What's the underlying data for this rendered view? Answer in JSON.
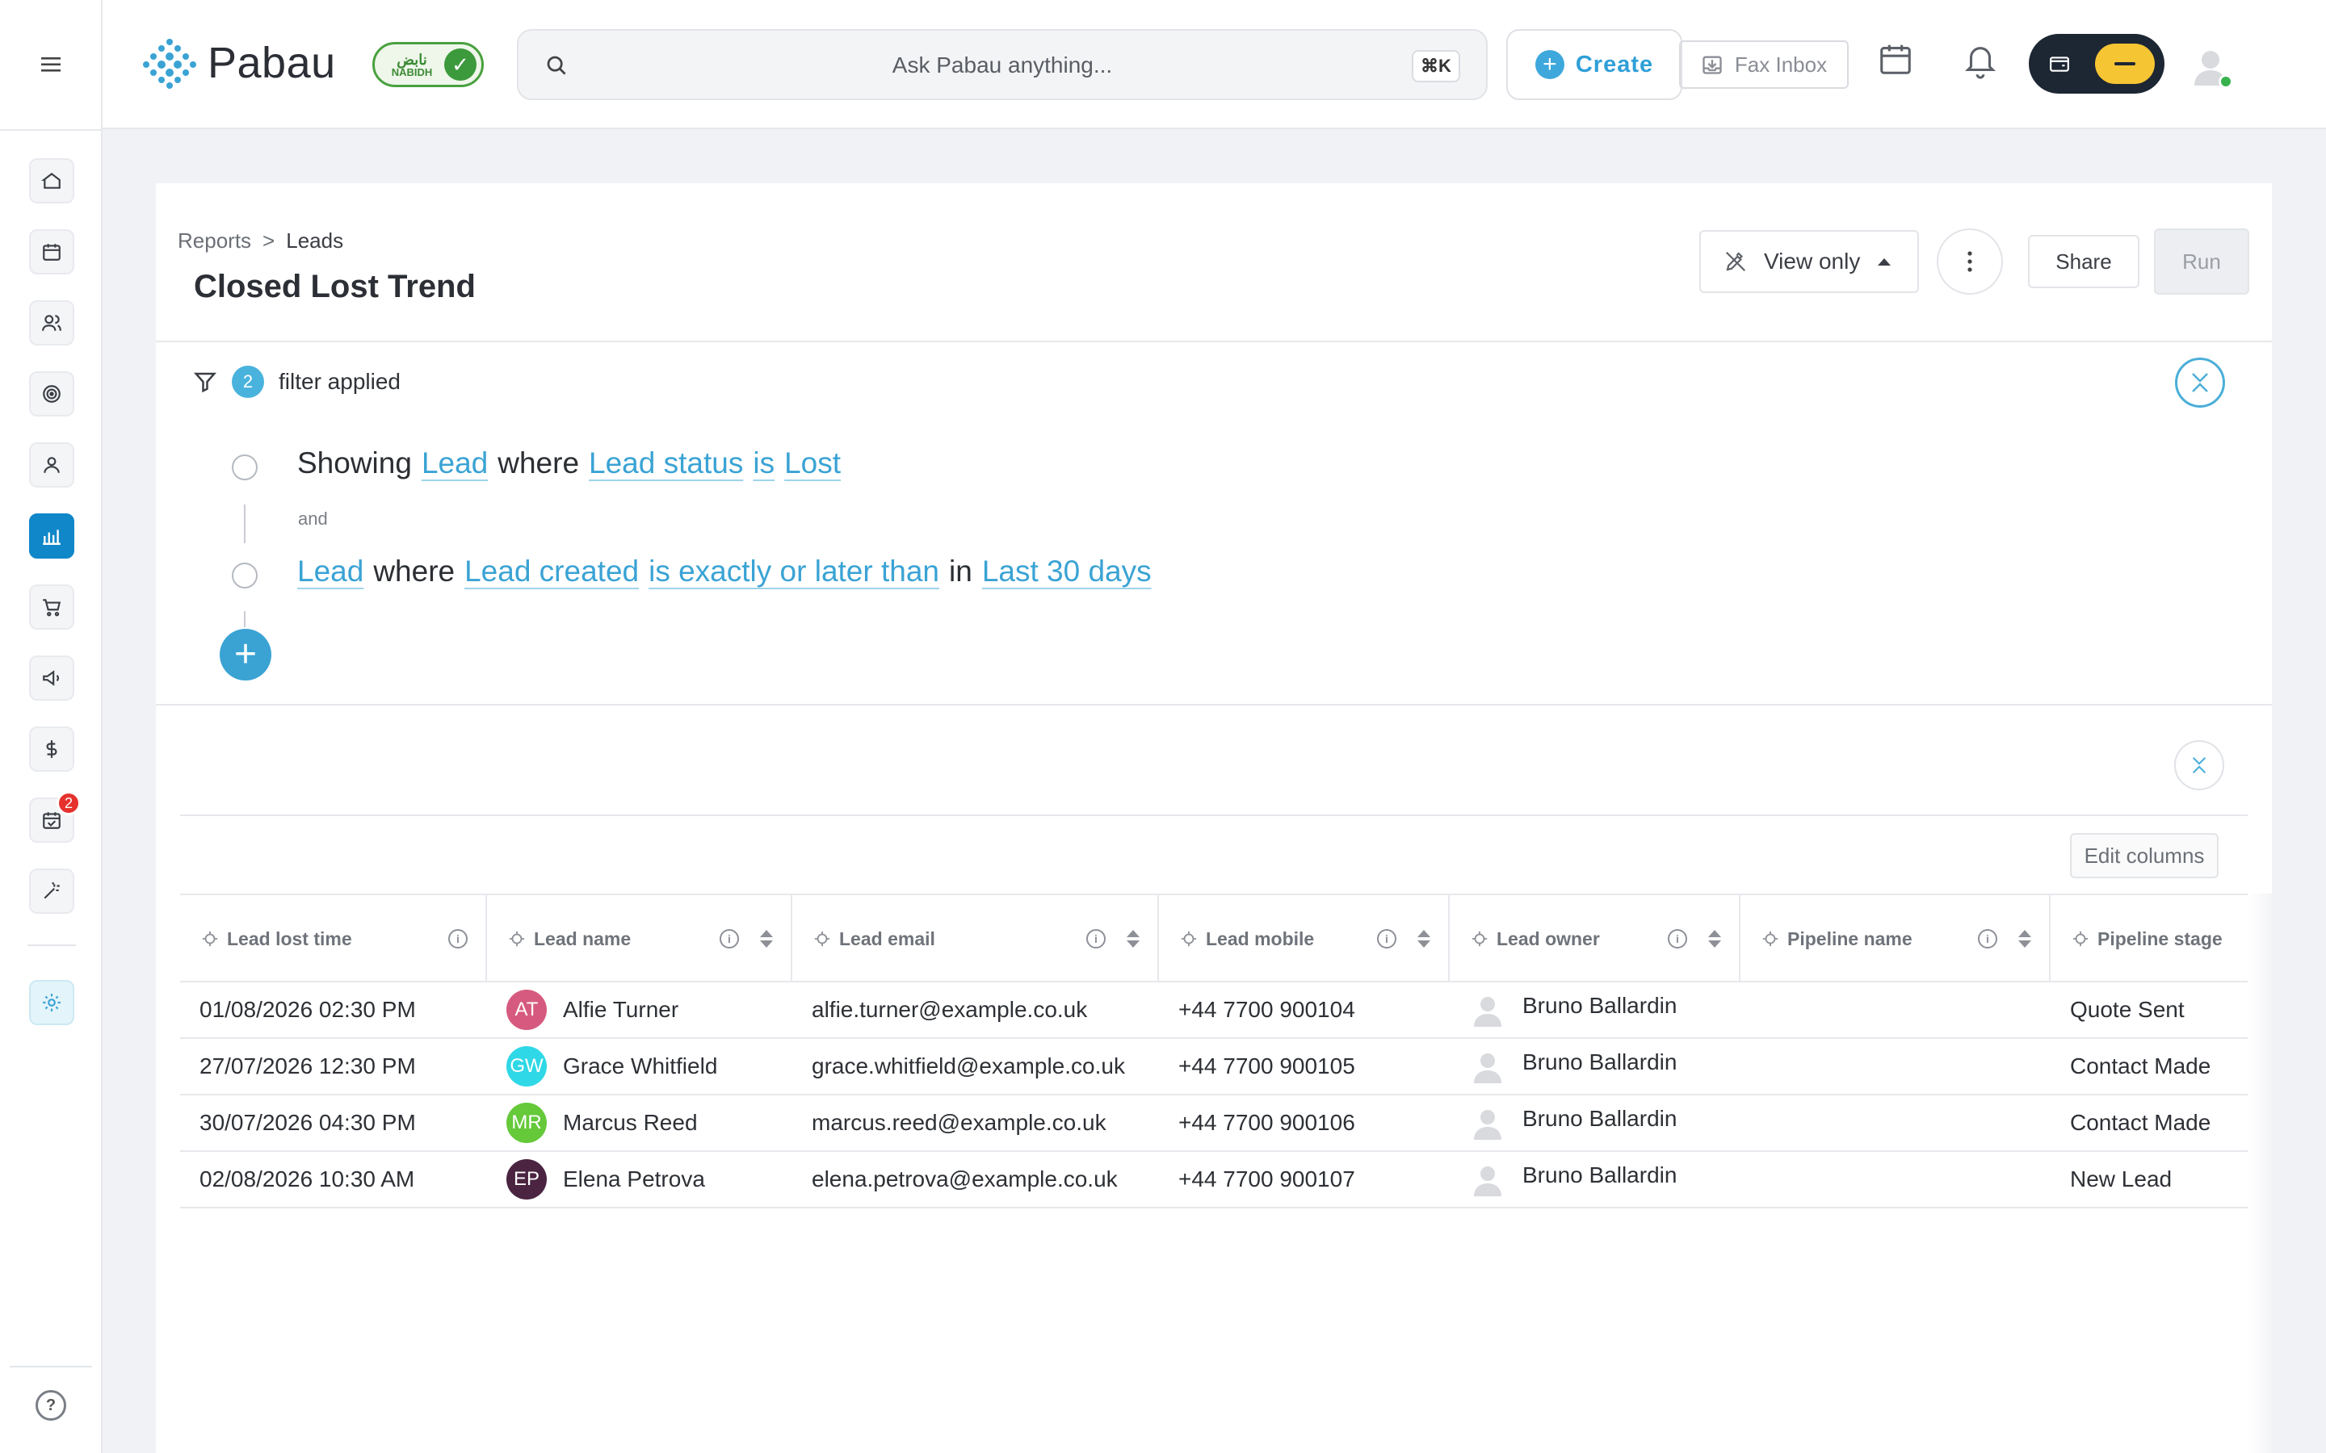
{
  "app": {
    "name": "Pabau",
    "badge": "NABIDH",
    "badge_script": "نابض"
  },
  "search": {
    "placeholder": "Ask Pabau anything...",
    "shortcut": "⌘K"
  },
  "topbar": {
    "create_label": "Create",
    "fax_label": "Fax Inbox"
  },
  "sidebar": {
    "items": [
      "home-icon",
      "calendar-icon",
      "contacts-icon",
      "target-icon",
      "user-icon",
      "reports-icon",
      "cart-icon",
      "megaphone-icon",
      "dollar-icon",
      "tasks-icon",
      "wand-icon",
      "settings-icon"
    ],
    "active": "reports-icon",
    "tasks_badge": "2"
  },
  "breadcrumb": {
    "root": "Reports",
    "separator": ">",
    "current": "Leads"
  },
  "page": {
    "title": "Closed Lost Trend"
  },
  "actions": {
    "view_mode": "View only",
    "share": "Share",
    "run": "Run"
  },
  "filters": {
    "count": "2",
    "label": "filter applied",
    "connector": "and",
    "conditions": [
      {
        "prefix": "Showing",
        "entity": "Lead",
        "where": "where",
        "field": "Lead status",
        "op": "is",
        "value": "Lost"
      },
      {
        "entity": "Lead",
        "where": "where",
        "field": "Lead created",
        "op": "is exactly or later than",
        "in": "in",
        "value": "Last 30 days"
      }
    ]
  },
  "table": {
    "edit_columns": "Edit columns",
    "columns": [
      "Lead lost time",
      "Lead name",
      "Lead email",
      "Lead mobile",
      "Lead owner",
      "Pipeline name",
      "Pipeline stage"
    ],
    "rows": [
      {
        "time": "01/08/2026 02:30 PM",
        "initials": "AT",
        "name": "Alfie Turner",
        "email": "alfie.turner@example.co.uk",
        "mobile": "+44 7700 900104",
        "owner": "Bruno Ballardin",
        "pipeline": "",
        "stage": "Quote Sent",
        "color": "#d65a7f"
      },
      {
        "time": "27/07/2026 12:30 PM",
        "initials": "GW",
        "name": "Grace Whitfield",
        "email": "grace.whitfield@example.co.uk",
        "mobile": "+44 7700 900105",
        "owner": "Bruno Ballardin",
        "pipeline": "",
        "stage": "Contact Made",
        "color": "#2fd8e6"
      },
      {
        "time": "30/07/2026 04:30 PM",
        "initials": "MR",
        "name": "Marcus Reed",
        "email": "marcus.reed@example.co.uk",
        "mobile": "+44 7700 900106",
        "owner": "Bruno Ballardin",
        "pipeline": "",
        "stage": "Contact Made",
        "color": "#65c93a"
      },
      {
        "time": "02/08/2026 10:30 AM",
        "initials": "EP",
        "name": "Elena Petrova",
        "email": "elena.petrova@example.co.uk",
        "mobile": "+44 7700 900107",
        "owner": "Bruno Ballardin",
        "pipeline": "",
        "stage": "New Lead",
        "color": "#4a2440"
      }
    ]
  },
  "colors": {
    "accent": "#3aa3d4",
    "active_nav": "#0f87c9",
    "badge_red": "#e6322e",
    "wallet": "#f6c533"
  }
}
